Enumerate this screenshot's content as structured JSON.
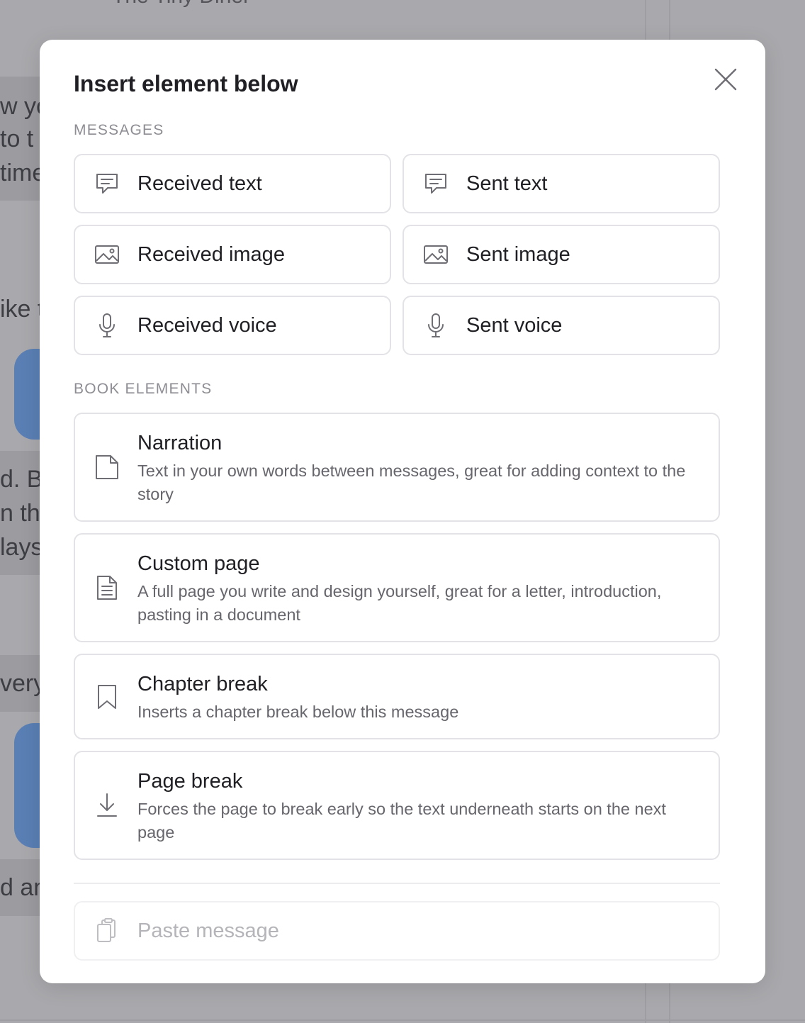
{
  "background": {
    "app_title": "The Tiny Diner",
    "fragments": [
      "w yo",
      "to t",
      "time",
      "ike t",
      "d. Be",
      "n the",
      "lays",
      "very",
      "d an"
    ]
  },
  "modal": {
    "title": "Insert element below",
    "close_icon": "close-icon",
    "sections": {
      "messages_label": "MESSAGES",
      "book_elements_label": "BOOK ELEMENTS"
    },
    "messages": [
      {
        "label": "Received text",
        "icon": "message-bubble-icon"
      },
      {
        "label": "Sent text",
        "icon": "message-bubble-icon"
      },
      {
        "label": "Received image",
        "icon": "image-icon"
      },
      {
        "label": "Sent image",
        "icon": "image-icon"
      },
      {
        "label": "Received voice",
        "icon": "microphone-icon"
      },
      {
        "label": "Sent voice",
        "icon": "microphone-icon"
      }
    ],
    "book_elements": [
      {
        "title": "Narration",
        "description": "Text in your own words between messages, great for adding context to the story",
        "icon": "page-icon"
      },
      {
        "title": "Custom page",
        "description": "A full page you write and design yourself, great for a letter, introduction, pasting in a document",
        "icon": "document-lines-icon"
      },
      {
        "title": "Chapter break",
        "description": "Inserts a chapter break below this message",
        "icon": "bookmark-icon"
      },
      {
        "title": "Page break",
        "description": "Forces the page to break early so the text underneath starts on the next page",
        "icon": "arrow-down-to-line-icon"
      }
    ],
    "paste": {
      "label": "Paste message",
      "icon": "clipboard-icon"
    }
  },
  "colors": {
    "overlay": "#a9a9ad",
    "modal_bg": "#ffffff",
    "border": "#e3e3e7",
    "text_primary": "#1f1f24",
    "text_secondary": "#66666c",
    "text_disabled": "#b4b4b9",
    "bubble_blue": "#5a7fb4"
  }
}
